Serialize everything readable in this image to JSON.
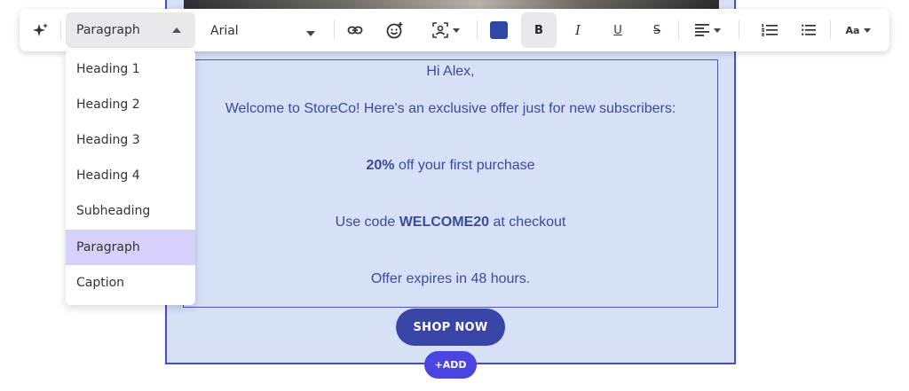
{
  "toolbar": {
    "text_style_value": "Paragraph",
    "font_value": "Arial",
    "bold_label": "B",
    "italic_label": "I",
    "underline_label": "U",
    "strike_label": "S",
    "text_size_label": "Aa",
    "text_color": "#2f48a8",
    "icons": [
      "sparkle-icon",
      "link-icon",
      "emoji-icon",
      "personalize-icon",
      "align-left-icon",
      "numbered-list-icon",
      "bullet-list-icon"
    ]
  },
  "style_menu": {
    "items": [
      "Heading 1",
      "Heading 2",
      "Heading 3",
      "Heading 4",
      "Subheading",
      "Paragraph",
      "Caption"
    ],
    "selected": "Paragraph"
  },
  "email": {
    "greeting": "Hi Alex,",
    "welcome": "Welcome to StoreCo! Here's an exclusive offer just for new subscribers:",
    "discount_bold": "20%",
    "discount_rest": "off your first purchase",
    "code_prefix": "Use code",
    "code": "WELCOME20",
    "code_suffix": "at checkout",
    "expiry": "Offer expires in 48 hours.",
    "cta_label": "SHOP NOW",
    "add_label": "+ADD"
  },
  "colors": {
    "section_bg": "#d6e0f7",
    "section_border": "#4b4ad4",
    "text": "#3b4a9a",
    "cta": "#3946a8",
    "add": "#4a44e0",
    "menu_selected": "#d4d2fb"
  }
}
